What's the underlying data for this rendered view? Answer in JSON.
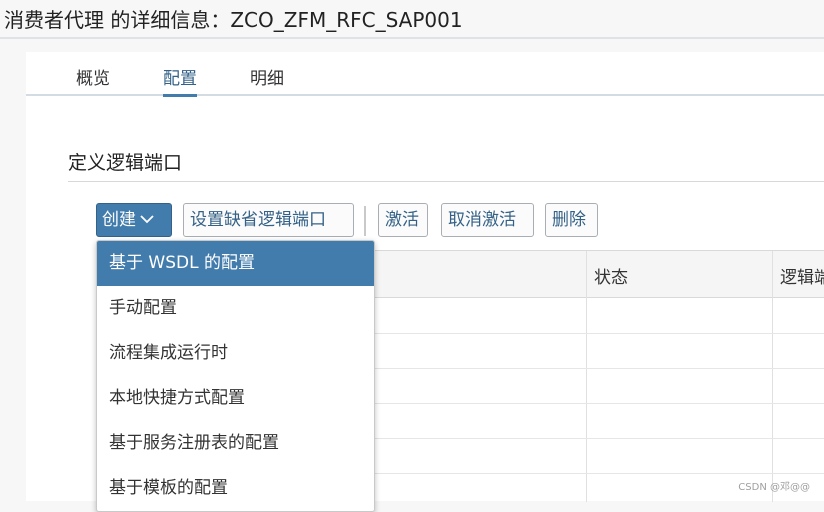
{
  "window": {
    "title": "消费者代理 的详细信息：ZCO_ZFM_RFC_SAP001"
  },
  "tabs": [
    {
      "label": "概览",
      "active": false
    },
    {
      "label": "配置",
      "active": true
    },
    {
      "label": "明细",
      "active": false
    }
  ],
  "section": {
    "title": "定义逻辑端口"
  },
  "toolbar": {
    "create_label": "创建",
    "set_default_label": "设置缺省逻辑端口",
    "activate_label": "激活",
    "deactivate_label": "取消激活",
    "delete_label": "删除"
  },
  "table": {
    "columns": [
      "状态",
      "逻辑端"
    ]
  },
  "create_menu": {
    "items": [
      {
        "label": "基于 WSDL 的配置",
        "selected": true
      },
      {
        "label": "手动配置",
        "selected": false
      },
      {
        "label": "流程集成运行时",
        "selected": false
      },
      {
        "label": "本地快捷方式配置",
        "selected": false
      },
      {
        "label": "基于服务注册表的配置",
        "selected": false
      },
      {
        "label": "基于模板的配置",
        "selected": false
      }
    ]
  },
  "watermark": "CSDN @邓@@",
  "colors": {
    "accent": "#427cac",
    "accent_text": "#346187",
    "background": "#f7f7f7"
  },
  "icons": {
    "create_dropdown": "chevron-down-icon"
  }
}
